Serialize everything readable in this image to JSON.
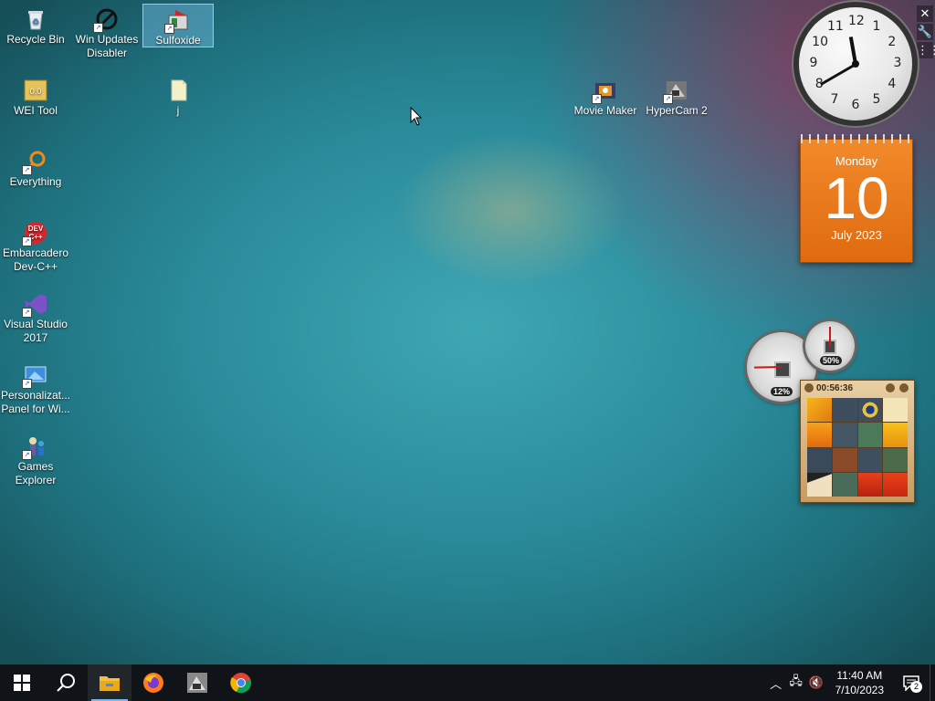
{
  "desktop_icons": [
    {
      "id": "recycle-bin",
      "label": "Recycle Bin",
      "selected": false
    },
    {
      "id": "win-updates-disabler",
      "label": "Win Updates Disabler",
      "selected": false
    },
    {
      "id": "sulfoxide",
      "label": "Sulfoxide",
      "selected": true
    },
    {
      "id": "wei-tool",
      "label": "WEI Tool",
      "selected": false
    },
    {
      "id": "j-file",
      "label": "j",
      "selected": false
    },
    {
      "id": "movie-maker",
      "label": "Movie Maker",
      "selected": false
    },
    {
      "id": "hypercam",
      "label": "HyperCam 2",
      "selected": false
    },
    {
      "id": "everything",
      "label": "Everything",
      "selected": false
    },
    {
      "id": "dev-cpp",
      "label": "Embarcadero Dev-C++",
      "selected": false
    },
    {
      "id": "visual-studio",
      "label": "Visual Studio 2017",
      "selected": false
    },
    {
      "id": "personalization-panel",
      "label": "Personalizat... Panel for Wi...",
      "selected": false
    },
    {
      "id": "games-explorer",
      "label": "Games Explorer",
      "selected": false
    }
  ],
  "icon_labels": {
    "recycle_bin": "Recycle Bin",
    "win_updates_1": "Win Updates",
    "win_updates_2": "Disabler",
    "sulfoxide": "Sulfoxide",
    "wei_tool": "WEI Tool",
    "j_file": "j",
    "movie_maker": "Movie Maker",
    "hypercam": "HyperCam 2",
    "everything": "Everything",
    "devcpp_1": "Embarcadero",
    "devcpp_2": "Dev-C++",
    "vs_1": "Visual Studio",
    "vs_2": "2017",
    "personalization_1": "Personalizat...",
    "personalization_2": "Panel for Wi...",
    "games_1": "Games",
    "games_2": "Explorer",
    "devcpp_icon_text_1": "DEV",
    "devcpp_icon_text_2": "C++"
  },
  "gadgets": {
    "clock": {
      "numbers": [
        "12",
        "1",
        "2",
        "3",
        "4",
        "5",
        "6",
        "7",
        "8",
        "9",
        "10",
        "11"
      ],
      "time": "11:40"
    },
    "calendar": {
      "weekday": "Monday",
      "day": "10",
      "month_year": "July 2023"
    },
    "cpu_meter": {
      "cpu_pct": "12%",
      "memory_pct": "50%",
      "cpu_value": 12,
      "memory_value": 50
    },
    "puzzle": {
      "timer": "00:56:36"
    }
  },
  "taskbar": {
    "pinned": [
      "start",
      "search",
      "file-explorer",
      "firefox",
      "hypercam",
      "chrome"
    ],
    "clock_time": "11:40 AM",
    "clock_date": "7/10/2023",
    "notification_count": "2"
  },
  "colors": {
    "accent": "#76b9ed",
    "calendar_orange": "#e8761a",
    "taskbar_bg": "#101418"
  }
}
